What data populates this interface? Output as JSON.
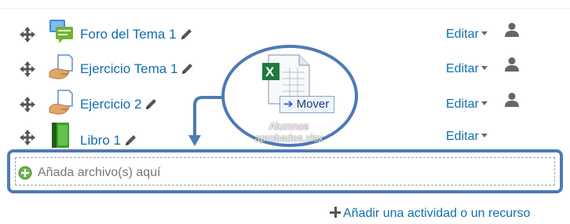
{
  "activities": [
    {
      "name": "Foro del Tema 1",
      "icon": "forum-icon",
      "edit_label": "Editar",
      "has_user_icon": true
    },
    {
      "name": "Ejercicio Tema 1",
      "icon": "assignment-icon",
      "edit_label": "Editar",
      "has_user_icon": true
    },
    {
      "name": "Ejercicio 2",
      "icon": "assignment-icon",
      "edit_label": "Editar",
      "has_user_icon": true
    },
    {
      "name": "Libro 1",
      "icon": "book-icon",
      "edit_label": "Editar",
      "has_user_icon": false
    }
  ],
  "dropzone": {
    "text": "Añada archivo(s) aquí"
  },
  "add_activity": {
    "label": "Añadir una actividad o un recurso"
  },
  "drag": {
    "file_name": "Alumnos aprobados.xlsx",
    "file_name_lines": [
      "Alumnos",
      "aprobados.xlsx"
    ],
    "tooltip": "Mover",
    "file_icon": "excel-file-icon"
  },
  "colors": {
    "link": "#0f6fae",
    "highlight_blue": "#4e7ab5",
    "forum_green": "#7dc243",
    "book_green": "#2e8b2e"
  }
}
